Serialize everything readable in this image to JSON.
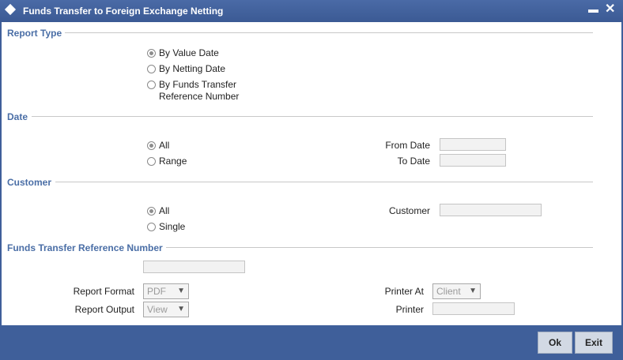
{
  "window": {
    "title": "Funds Transfer to Foreign Exchange Netting",
    "minimize_label": "▬",
    "close_label": "✕"
  },
  "report_type": {
    "heading": "Report Type",
    "options": [
      {
        "label": "By Value Date",
        "selected": true
      },
      {
        "label": "By Netting Date",
        "selected": false
      },
      {
        "label_line1": "By Funds Transfer",
        "label_line2": "Reference Number",
        "selected": false
      }
    ]
  },
  "date": {
    "heading": "Date",
    "options": [
      {
        "label": "All",
        "selected": true
      },
      {
        "label": "Range",
        "selected": false
      }
    ],
    "from_label": "From Date",
    "from_value": "",
    "to_label": "To Date",
    "to_value": ""
  },
  "customer": {
    "heading": "Customer",
    "options": [
      {
        "label": "All",
        "selected": true
      },
      {
        "label": "Single",
        "selected": false
      }
    ],
    "customer_label": "Customer",
    "customer_value": ""
  },
  "ft_reference": {
    "heading": "Funds Transfer Reference Number",
    "value": ""
  },
  "report": {
    "format_label": "Report Format",
    "format_value": "PDF",
    "output_label": "Report Output",
    "output_value": "View",
    "printer_at_label": "Printer At",
    "printer_at_value": "Client",
    "printer_label": "Printer",
    "printer_value": ""
  },
  "buttons": {
    "ok": "Ok",
    "exit": "Exit"
  }
}
